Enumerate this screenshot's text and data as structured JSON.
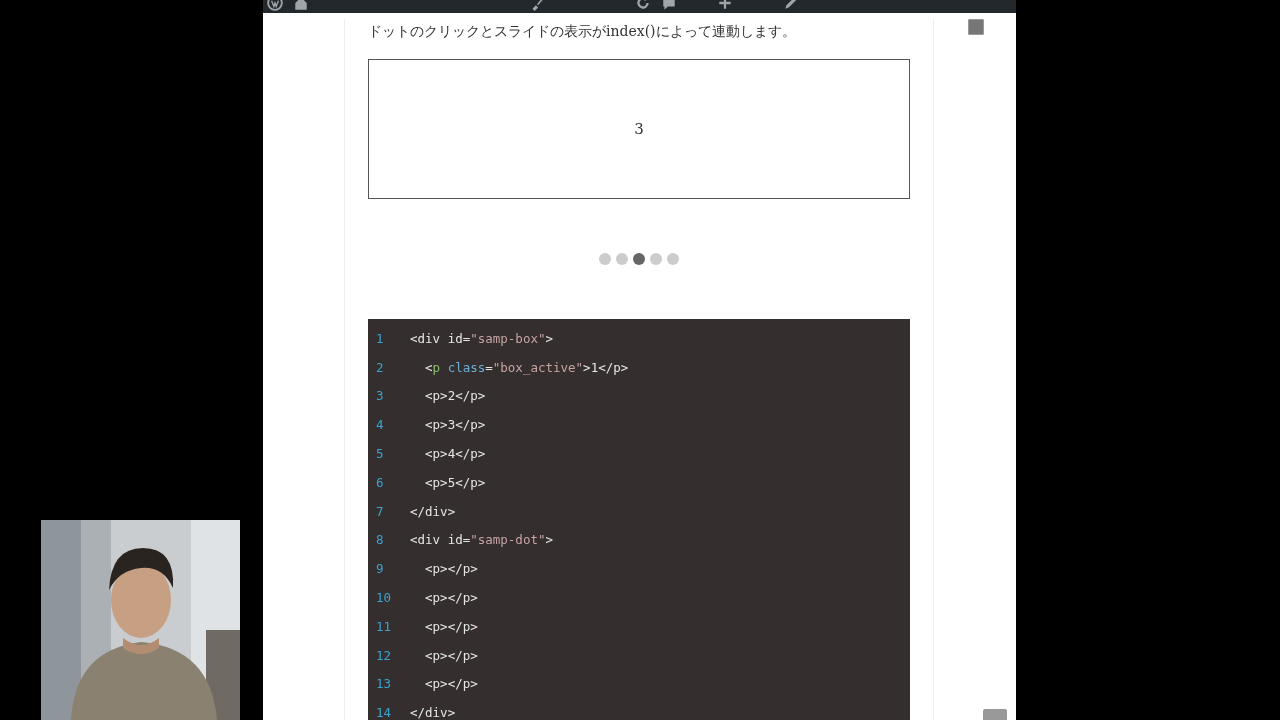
{
  "admin_bar": {
    "items": [
      {
        "kind": "logo"
      },
      {
        "kind": "home"
      },
      {
        "kind": "brush"
      },
      {
        "kind": "updates"
      },
      {
        "kind": "comments"
      },
      {
        "kind": "new"
      },
      {
        "kind": "edit"
      }
    ]
  },
  "article": {
    "intro": "ドットのクリックとスライドの表示がindex()によって連動します。",
    "slide": {
      "text": "3"
    },
    "dots": [
      {
        "selected": false
      },
      {
        "selected": false
      },
      {
        "selected": true
      },
      {
        "selected": false
      },
      {
        "selected": false
      }
    ],
    "code": [
      {
        "number": "1",
        "tokens": [
          {
            "kind": "plain",
            "text": "<div "
          },
          {
            "kind": "plain",
            "text": "id="
          },
          {
            "kind": "string",
            "text": "\"samp-box\""
          },
          {
            "kind": "plain",
            "text": ">"
          }
        ]
      },
      {
        "number": "2",
        "tokens": [
          {
            "kind": "plain",
            "text": "  <"
          },
          {
            "kind": "tag",
            "text": "p"
          },
          {
            "kind": "attr",
            "text": " class"
          },
          {
            "kind": "plain",
            "text": "="
          },
          {
            "kind": "string",
            "text": "\"box_active\""
          },
          {
            "kind": "plain",
            "text": ">1</p>"
          }
        ]
      },
      {
        "number": "3",
        "tokens": [
          {
            "kind": "plain",
            "text": "  <p>2</p>"
          }
        ]
      },
      {
        "number": "4",
        "tokens": [
          {
            "kind": "plain",
            "text": "  <p>3</p>"
          }
        ]
      },
      {
        "number": "5",
        "tokens": [
          {
            "kind": "plain",
            "text": "  <p>4</p>"
          }
        ]
      },
      {
        "number": "6",
        "tokens": [
          {
            "kind": "plain",
            "text": "  <p>5</p>"
          }
        ]
      },
      {
        "number": "7",
        "tokens": [
          {
            "kind": "plain",
            "text": "</div>"
          }
        ]
      },
      {
        "number": "8",
        "tokens": [
          {
            "kind": "plain",
            "text": "<div id="
          },
          {
            "kind": "string",
            "text": "\"samp-dot\""
          },
          {
            "kind": "plain",
            "text": ">"
          }
        ]
      },
      {
        "number": "9",
        "tokens": [
          {
            "kind": "plain",
            "text": "  <p></p>"
          }
        ]
      },
      {
        "number": "10",
        "tokens": [
          {
            "kind": "plain",
            "text": "  <p></p>"
          }
        ]
      },
      {
        "number": "11",
        "tokens": [
          {
            "kind": "plain",
            "text": "  <p></p>"
          }
        ]
      },
      {
        "number": "12",
        "tokens": [
          {
            "kind": "plain",
            "text": "  <p></p>"
          }
        ]
      },
      {
        "number": "13",
        "tokens": [
          {
            "kind": "plain",
            "text": "  <p></p>"
          }
        ]
      },
      {
        "number": "14",
        "tokens": [
          {
            "kind": "plain",
            "text": "</div>"
          }
        ]
      }
    ]
  }
}
